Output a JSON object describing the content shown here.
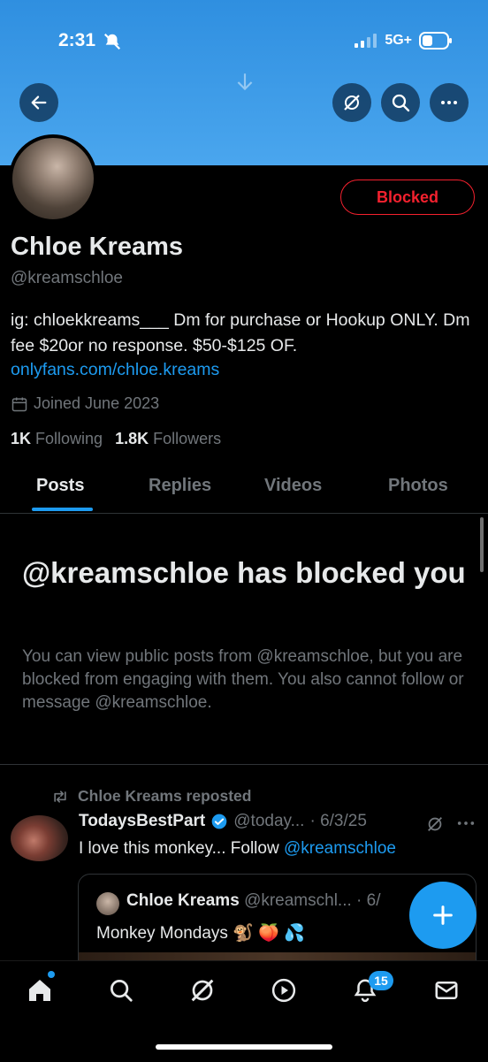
{
  "status_bar": {
    "time": "2:31",
    "network": "5G+"
  },
  "profile": {
    "name": "Chloe Kreams",
    "handle": "@kreamschloe",
    "blocked_label": "Blocked",
    "bio": "ig: chloekkreams___ Dm for purchase or Hookup ONLY. Dm fee $20or no response. $50-$125 OF.",
    "link": "onlyfans.com/chloe.kreams",
    "joined": "Joined June 2023",
    "following_count": "1K",
    "following_label": "Following",
    "followers_count": "1.8K",
    "followers_label": "Followers"
  },
  "tabs": [
    {
      "label": "Posts"
    },
    {
      "label": "Replies"
    },
    {
      "label": "Videos"
    },
    {
      "label": "Photos"
    }
  ],
  "blocked_notice": {
    "title": "@kreamschloe has blocked you",
    "description": "You can view public posts from @kreamschloe, but you are blocked from engaging with them. You also cannot follow or message @kreamschloe."
  },
  "post": {
    "repost_label": "Chloe Kreams reposted",
    "author_name": "TodaysBestPart",
    "author_handle": "@today...",
    "date": "· 6/3/25",
    "text": "I love this monkey... Follow ",
    "mention": "@kreamschloe",
    "quote": {
      "author_name": "Chloe Kreams",
      "author_handle": "@kreamschl... · 6/",
      "text": "Monkey Mondays 🐒 🍑 💦"
    }
  },
  "bottom_nav": {
    "notification_badge": "15"
  },
  "colors": {
    "accent": "#1d9bf0",
    "blocked": "#f4212e",
    "banner": "#3d9ce9"
  }
}
